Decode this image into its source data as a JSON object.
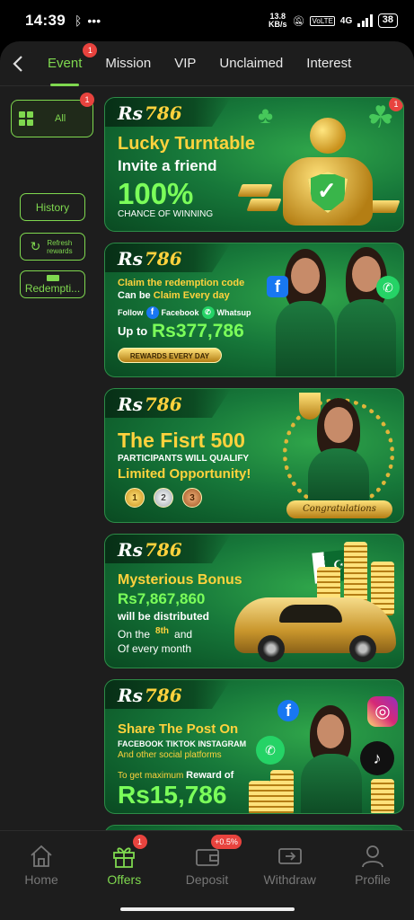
{
  "status": {
    "time": "14:39",
    "speed_value": "13.8",
    "speed_unit": "KB/s",
    "network": "4G",
    "battery": "38"
  },
  "topnav": {
    "tabs": [
      {
        "label": "Event",
        "badge": "1"
      },
      {
        "label": "Mission"
      },
      {
        "label": "VIP"
      },
      {
        "label": "Unclaimed"
      },
      {
        "label": "Interest"
      }
    ]
  },
  "sidebar": {
    "all_label": "All",
    "all_badge": "1",
    "history_label": "History",
    "refresh_label": "Refresh rewards",
    "redeem_label": "Redempti..."
  },
  "logo": {
    "rs": "Rs",
    "num": "786"
  },
  "banners": {
    "b1": {
      "badge": "1",
      "title": "Lucky Turntable",
      "line2": "Invite a friend",
      "percent": "100%",
      "line4": "CHANCE OF WINNING"
    },
    "b2": {
      "line1": "Claim the redemption code",
      "line2a": "Can be",
      "line2b": "Claim Every day",
      "follow": "Follow",
      "facebook": "Facebook",
      "whatsapp": "Whatsup",
      "upto": "Up to",
      "amount": "Rs377,786",
      "pill": "REWARDS EVERY DAY"
    },
    "b3": {
      "title": "The Fisrt 500",
      "line2": "PARTICIPANTS WILL QUALIFY",
      "line3": "Limited Opportunity!",
      "medals": [
        "1",
        "2",
        "3"
      ],
      "congrats": "Congratulations"
    },
    "b4": {
      "title": "Mysterious Bonus",
      "amount": "Rs7,867,860",
      "line3": "will be distributed",
      "on": "On the",
      "day": "8th",
      "and": "and",
      "every": "Of every month"
    },
    "b5": {
      "title": "Share The Post On",
      "line2": "FACEBOOK TIKTOK INSTAGRAM",
      "line3": "And other social platforms",
      "line4a": "To get maximum",
      "line4b": "Reward of",
      "amount": "Rs15,786"
    }
  },
  "bottomnav": {
    "items": [
      {
        "label": "Home"
      },
      {
        "label": "Offers",
        "badge": "1"
      },
      {
        "label": "Deposit",
        "badge": "+0.5%"
      },
      {
        "label": "Withdraw"
      },
      {
        "label": "Profile"
      }
    ]
  },
  "colors": {
    "accent": "#7fd84f",
    "badge": "#e8433e",
    "background": "#1d1d1d",
    "banner_green": "#17783a",
    "gold": "#ffd23d"
  }
}
